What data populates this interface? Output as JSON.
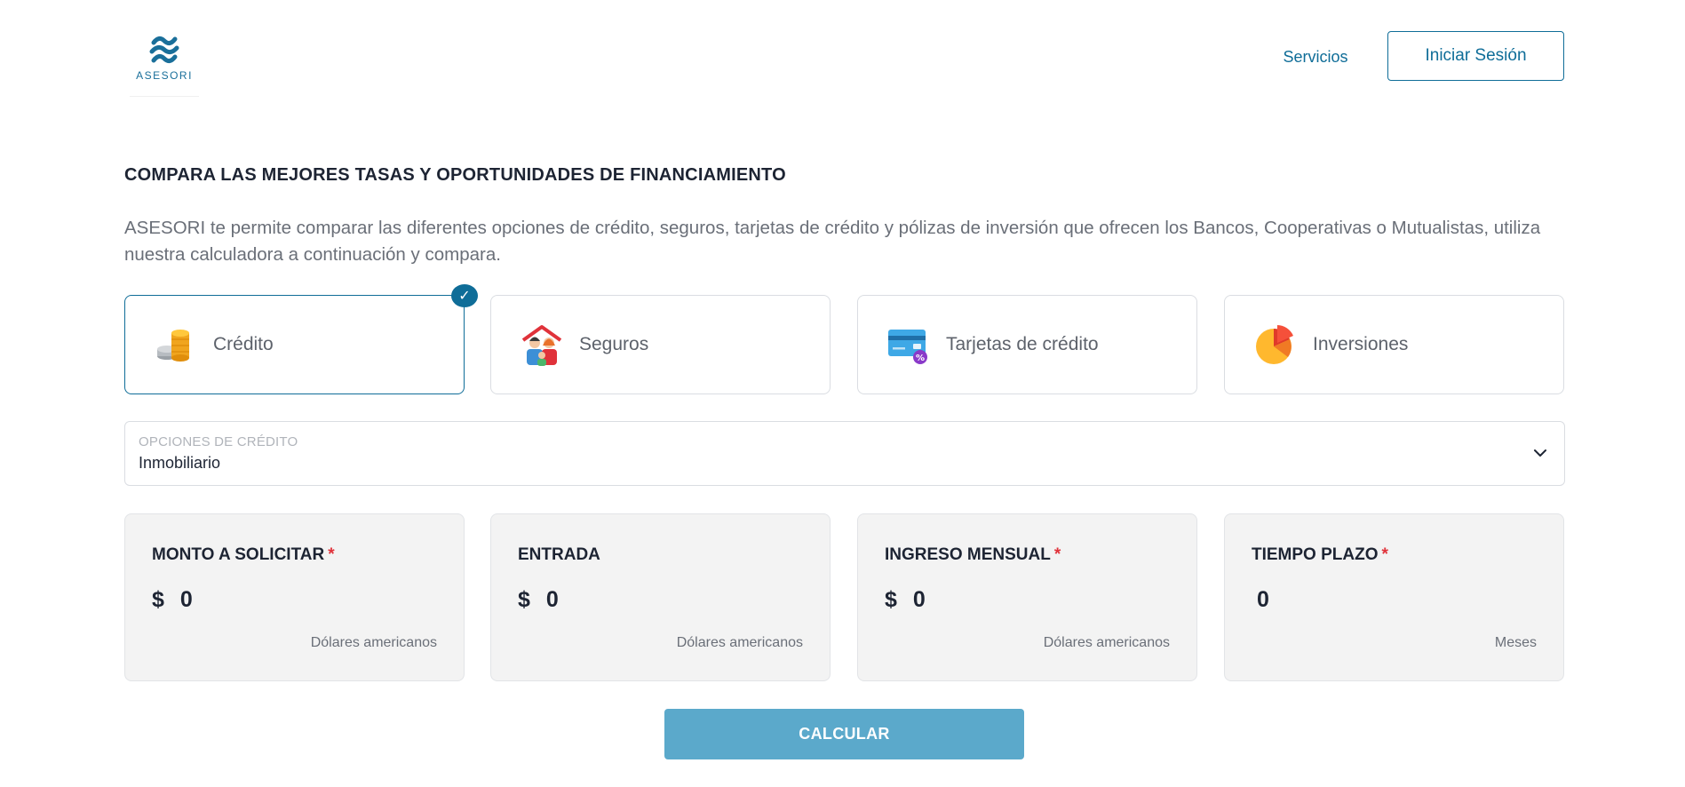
{
  "brand": {
    "name": "ASESORI"
  },
  "nav": {
    "services": "Servicios",
    "login": "Iniciar Sesión"
  },
  "hero": {
    "title": "COMPARA LAS MEJORES TASAS Y OPORTUNIDADES DE FINANCIAMIENTO",
    "description": "ASESORI te permite comparar las diferentes opciones de crédito, seguros, tarjetas de crédito y pólizas de inversión que ofrecen los Bancos, Cooperativas o Mutualistas, utiliza nuestra calculadora a continuación y compara."
  },
  "categories": [
    {
      "label": "Crédito",
      "icon": "coins-icon",
      "selected": true
    },
    {
      "label": "Seguros",
      "icon": "family-house-icon",
      "selected": false
    },
    {
      "label": "Tarjetas de crédito",
      "icon": "credit-card-icon",
      "selected": false
    },
    {
      "label": "Inversiones",
      "icon": "pie-chart-icon",
      "selected": false
    }
  ],
  "credit_options": {
    "label": "OPCIONES DE CRÉDITO",
    "value": "Inmobiliario"
  },
  "fields": [
    {
      "label": "MONTO A SOLICITAR",
      "required": "*",
      "currency": "$",
      "value": "0",
      "unit": "Dólares americanos"
    },
    {
      "label": "ENTRADA",
      "currency": "$",
      "value": "0",
      "unit": "Dólares americanos"
    },
    {
      "label": "INGRESO MENSUAL",
      "required": "*",
      "currency": "$",
      "value": "0",
      "unit": "Dólares americanos"
    },
    {
      "label": "TIEMPO PLAZO",
      "required": "*",
      "value": "0",
      "unit": "Meses"
    }
  ],
  "actions": {
    "calculate": "CALCULAR"
  },
  "colors": {
    "primary": "#0f6d98",
    "button": "#5ba9cb",
    "required": "#e0323a"
  }
}
